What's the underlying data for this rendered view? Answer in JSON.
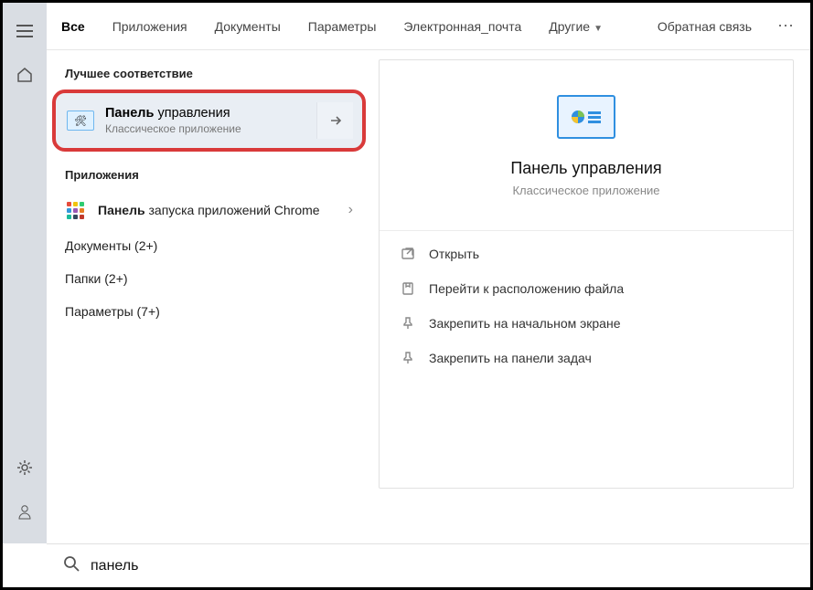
{
  "tabs": {
    "all": "Все",
    "apps": "Приложения",
    "docs": "Документы",
    "params": "Параметры",
    "email": "Электронная_почта",
    "other": "Другие",
    "feedback": "Обратная связь"
  },
  "sections": {
    "best_match": "Лучшее соответствие",
    "apps": "Приложения"
  },
  "best_match_item": {
    "title_bold": "Панель",
    "title_rest": " управления",
    "subtitle": "Классическое приложение"
  },
  "apps_list": {
    "item0": {
      "title_bold": "Панель",
      "title_rest": " запуска приложений Chrome"
    }
  },
  "rows": {
    "docs": "Документы (2+)",
    "folders": "Папки (2+)",
    "params": "Параметры (7+)"
  },
  "preview": {
    "title": "Панель управления",
    "subtitle": "Классическое приложение",
    "actions": {
      "open": "Открыть",
      "location": "Перейти к расположению файла",
      "pin_start": "Закрепить на начальном экране",
      "pin_taskbar": "Закрепить на панели задач"
    }
  },
  "search": {
    "value": "панель"
  },
  "icons": {
    "menu": "menu-icon",
    "home": "home-icon",
    "settings": "gear-icon",
    "account": "person-icon",
    "search": "search-icon",
    "arrow_right": "arrow-right-icon",
    "chevron_right": "chevron-right-icon",
    "chevron_down": "chevron-down-icon",
    "control_panel": "control-panel-icon",
    "chrome_apps": "chrome-apps-icon",
    "open": "open-icon",
    "location": "file-location-icon",
    "pin_start": "pin-start-icon",
    "pin_taskbar": "pin-taskbar-icon",
    "more": "more-icon"
  },
  "colors": {
    "highlight_border": "#d93a3a",
    "rail_bg": "#d9dde3",
    "accent": "#2f8fe0"
  }
}
